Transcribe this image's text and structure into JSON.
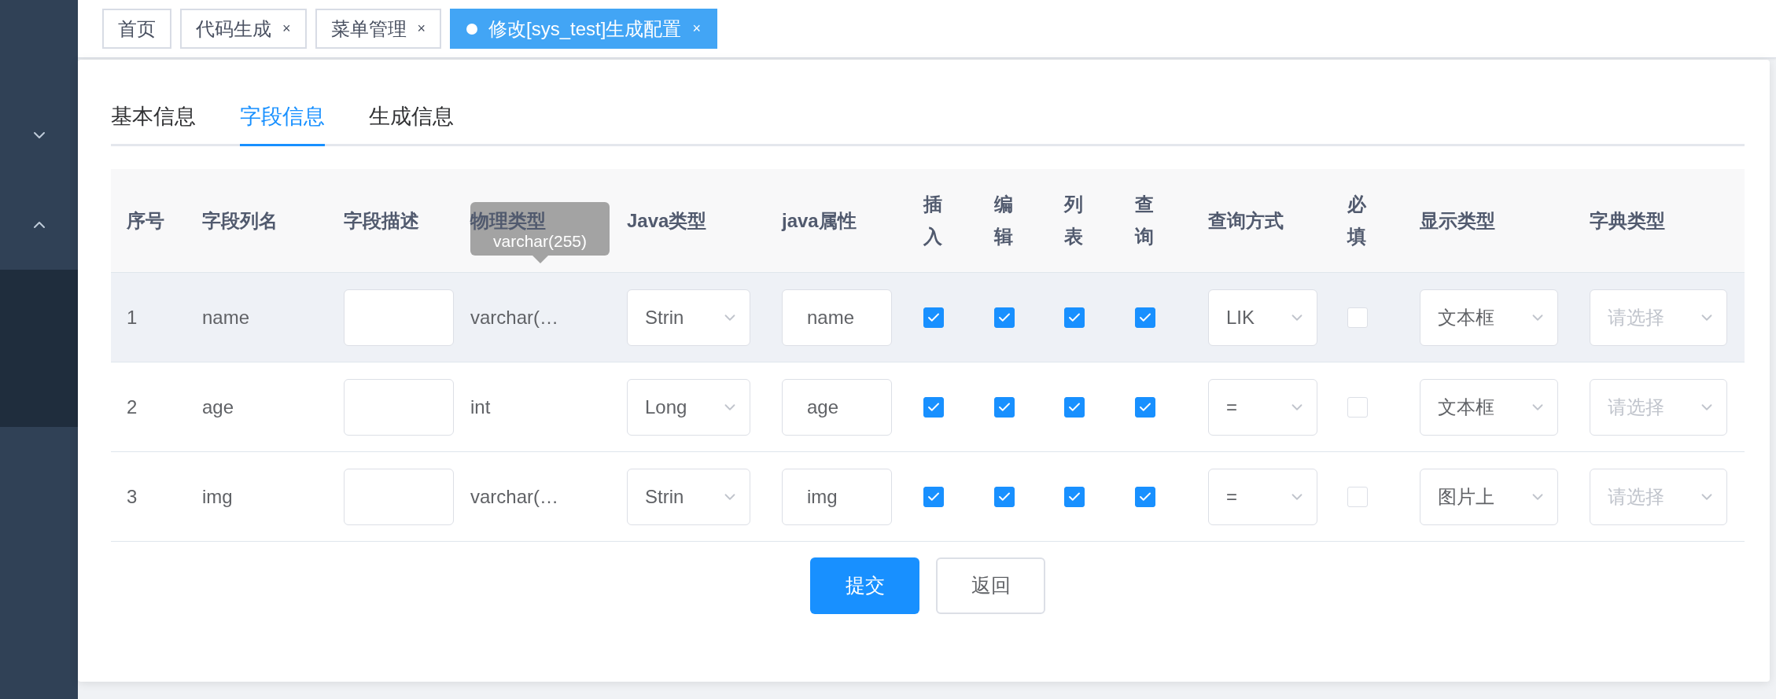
{
  "tags_view": [
    {
      "label": "首页",
      "closable": false,
      "selected": false
    },
    {
      "label": "代码生成",
      "closable": true,
      "selected": false
    },
    {
      "label": "菜单管理",
      "closable": true,
      "selected": false
    },
    {
      "label": "修改[sys_test]生成配置",
      "closable": true,
      "selected": true
    }
  ],
  "close_mark": "×",
  "tabs": [
    {
      "label": "基本信息",
      "selected": false
    },
    {
      "label": "字段信息",
      "selected": true
    },
    {
      "label": "生成信息",
      "selected": false
    }
  ],
  "table": {
    "columns": [
      "序号",
      "字段列名",
      "字段描述",
      "物理类型",
      "Java类型",
      "java属性",
      "插入",
      "编辑",
      "列表",
      "查询",
      "查询方式",
      "必填",
      "显示类型",
      "字典类型"
    ],
    "tooltip": "varchar(255)",
    "rows": [
      {
        "index": "1",
        "column_name": "name",
        "physical_type": "varchar(…",
        "java_type": "Strin",
        "java_field": "name",
        "insert": true,
        "edit": true,
        "list": true,
        "query": true,
        "query_type": "LIK",
        "required": false,
        "display_type": "文本框",
        "dict_type_placeholder": "请选择",
        "hovered": true
      },
      {
        "index": "2",
        "column_name": "age",
        "physical_type": "int",
        "java_type": "Long",
        "java_field": "age",
        "insert": true,
        "edit": true,
        "list": true,
        "query": true,
        "query_type": "=",
        "required": false,
        "display_type": "文本框",
        "dict_type_placeholder": "请选择",
        "hovered": false
      },
      {
        "index": "3",
        "column_name": "img",
        "physical_type": "varchar(…",
        "java_type": "Strin",
        "java_field": "img",
        "insert": true,
        "edit": true,
        "list": true,
        "query": true,
        "query_type": "=",
        "required": false,
        "display_type": "图片上",
        "dict_type_placeholder": "请选择",
        "hovered": false
      }
    ]
  },
  "buttons": [
    {
      "label": "提交",
      "kind": "primary"
    },
    {
      "label": "返回",
      "kind": "default"
    }
  ]
}
